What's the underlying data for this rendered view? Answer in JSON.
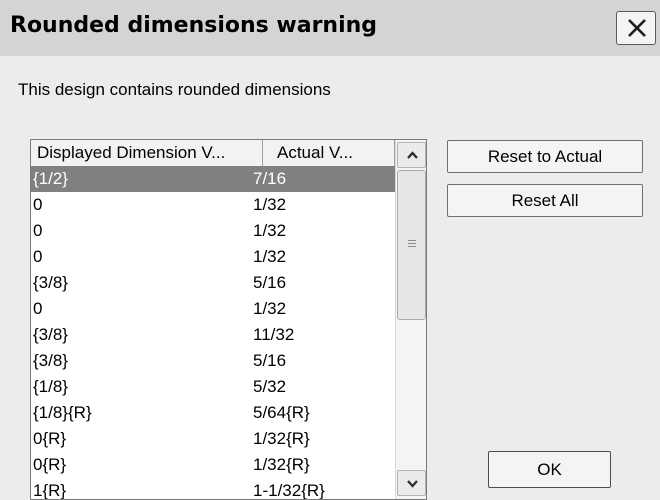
{
  "dialog": {
    "title": "Rounded dimensions warning",
    "message": "This design contains rounded dimensions"
  },
  "table": {
    "columns": [
      "Displayed Dimension V...",
      "Actual V..."
    ],
    "selected_row": 0,
    "rows": [
      {
        "displayed": "{1/2}",
        "actual": "7/16"
      },
      {
        "displayed": "0",
        "actual": "1/32"
      },
      {
        "displayed": "0",
        "actual": "1/32"
      },
      {
        "displayed": "0",
        "actual": "1/32"
      },
      {
        "displayed": "{3/8}",
        "actual": "5/16"
      },
      {
        "displayed": "0",
        "actual": "1/32"
      },
      {
        "displayed": "{3/8}",
        "actual": "11/32"
      },
      {
        "displayed": "{3/8}",
        "actual": "5/16"
      },
      {
        "displayed": "{1/8}",
        "actual": "5/32"
      },
      {
        "displayed": "{1/8}{R}",
        "actual": "5/64{R}"
      },
      {
        "displayed": "0{R}",
        "actual": "1/32{R}"
      },
      {
        "displayed": "0{R}",
        "actual": "1/32{R}"
      },
      {
        "displayed": "1{R}",
        "actual": "1-1/32{R}"
      }
    ]
  },
  "buttons": {
    "reset_actual": "Reset to Actual",
    "reset_all": "Reset All",
    "ok": "OK"
  },
  "icons": {
    "close": "close-icon",
    "scroll_up": "chevron-up-icon",
    "scroll_down": "chevron-down-icon"
  }
}
